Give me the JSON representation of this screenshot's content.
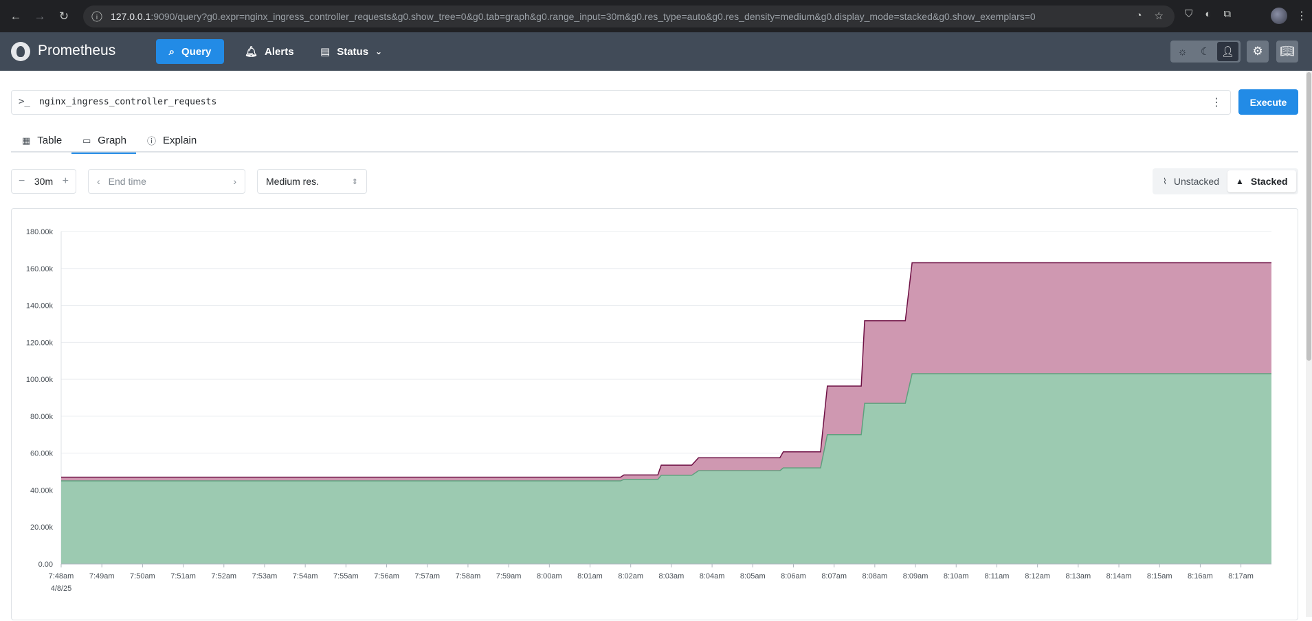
{
  "browser": {
    "url_host": "127.0.0.1",
    "url_rest": ":9090/query?g0.expr=nginx_ingress_controller_requests&g0.show_tree=0&g0.tab=graph&g0.range_input=30m&g0.res_type=auto&g0.res_density=medium&g0.display_mode=stacked&g0.show_exemplars=0"
  },
  "header": {
    "brand": "Prometheus",
    "nav": {
      "query": "Query",
      "alerts": "Alerts",
      "status": "Status"
    }
  },
  "query": {
    "expression": "nginx_ingress_controller_requests",
    "execute_label": "Execute"
  },
  "tabs": [
    {
      "label": "Table",
      "icon": "table-icon"
    },
    {
      "label": "Graph",
      "icon": "graph-icon",
      "active": true
    },
    {
      "label": "Explain",
      "icon": "info-icon"
    }
  ],
  "controls": {
    "range": "30m",
    "end_time_placeholder": "End time",
    "resolution": "Medium res.",
    "unstacked_label": "Unstacked",
    "stacked_label": "Stacked",
    "display_mode": "stacked"
  },
  "colors": {
    "accent": "#228be6",
    "header_bg": "#414b58",
    "series_green_fill": "#9ccab1",
    "series_green_line": "#5fa07e",
    "series_purple_fill": "#cf98b1",
    "series_purple_line": "#6e1044"
  },
  "chart_data": {
    "type": "area",
    "stacked": true,
    "ylim": [
      0,
      180000
    ],
    "yticks": [
      "0.00",
      "20.00k",
      "40.00k",
      "60.00k",
      "80.00k",
      "100.00k",
      "120.00k",
      "140.00k",
      "160.00k",
      "180.00k"
    ],
    "ytick_values": [
      0,
      20000,
      40000,
      60000,
      80000,
      100000,
      120000,
      140000,
      160000,
      180000
    ],
    "xlim": [
      "7:48am",
      "8:17:45am"
    ],
    "xticks": [
      "7:48am",
      "7:49am",
      "7:50am",
      "7:51am",
      "7:52am",
      "7:53am",
      "7:54am",
      "7:55am",
      "7:56am",
      "7:57am",
      "7:58am",
      "7:59am",
      "8:00am",
      "8:01am",
      "8:02am",
      "8:03am",
      "8:04am",
      "8:05am",
      "8:06am",
      "8:07am",
      "8:08am",
      "8:09am",
      "8:10am",
      "8:11am",
      "8:12am",
      "8:13am",
      "8:14am",
      "8:15am",
      "8:16am",
      "8:17am"
    ],
    "xtick_date": "4/8/25",
    "series": [
      {
        "x": [
          "7:48am",
          "8:01:45am",
          "8:01:50am",
          "8:02:40am",
          "8:02:45am",
          "8:03:30am",
          "8:03:40am",
          "8:05:40am",
          "8:05:45am",
          "8:06:40am",
          "8:06:50am",
          "8:07:40am",
          "8:07:45am",
          "8:08:45am",
          "8:08:55am",
          "8:17:45am"
        ],
        "values": [
          45000,
          45000,
          45800,
          45800,
          48000,
          48000,
          50500,
          50500,
          52000,
          52000,
          70000,
          70000,
          87000,
          87000,
          103000,
          103000
        ]
      },
      {
        "x": [
          "7:48am",
          "8:01:45am",
          "8:01:50am",
          "8:02:40am",
          "8:02:45am",
          "8:03:30am",
          "8:03:40am",
          "8:05:40am",
          "8:05:45am",
          "8:06:40am",
          "8:06:50am",
          "8:07:40am",
          "8:07:45am",
          "8:08:45am",
          "8:08:55am",
          "8:17:45am"
        ],
        "values": [
          2000,
          2000,
          2400,
          2400,
          5500,
          5500,
          7000,
          7000,
          8700,
          8700,
          26300,
          26300,
          44700,
          44700,
          60100,
          60100
        ]
      }
    ]
  }
}
